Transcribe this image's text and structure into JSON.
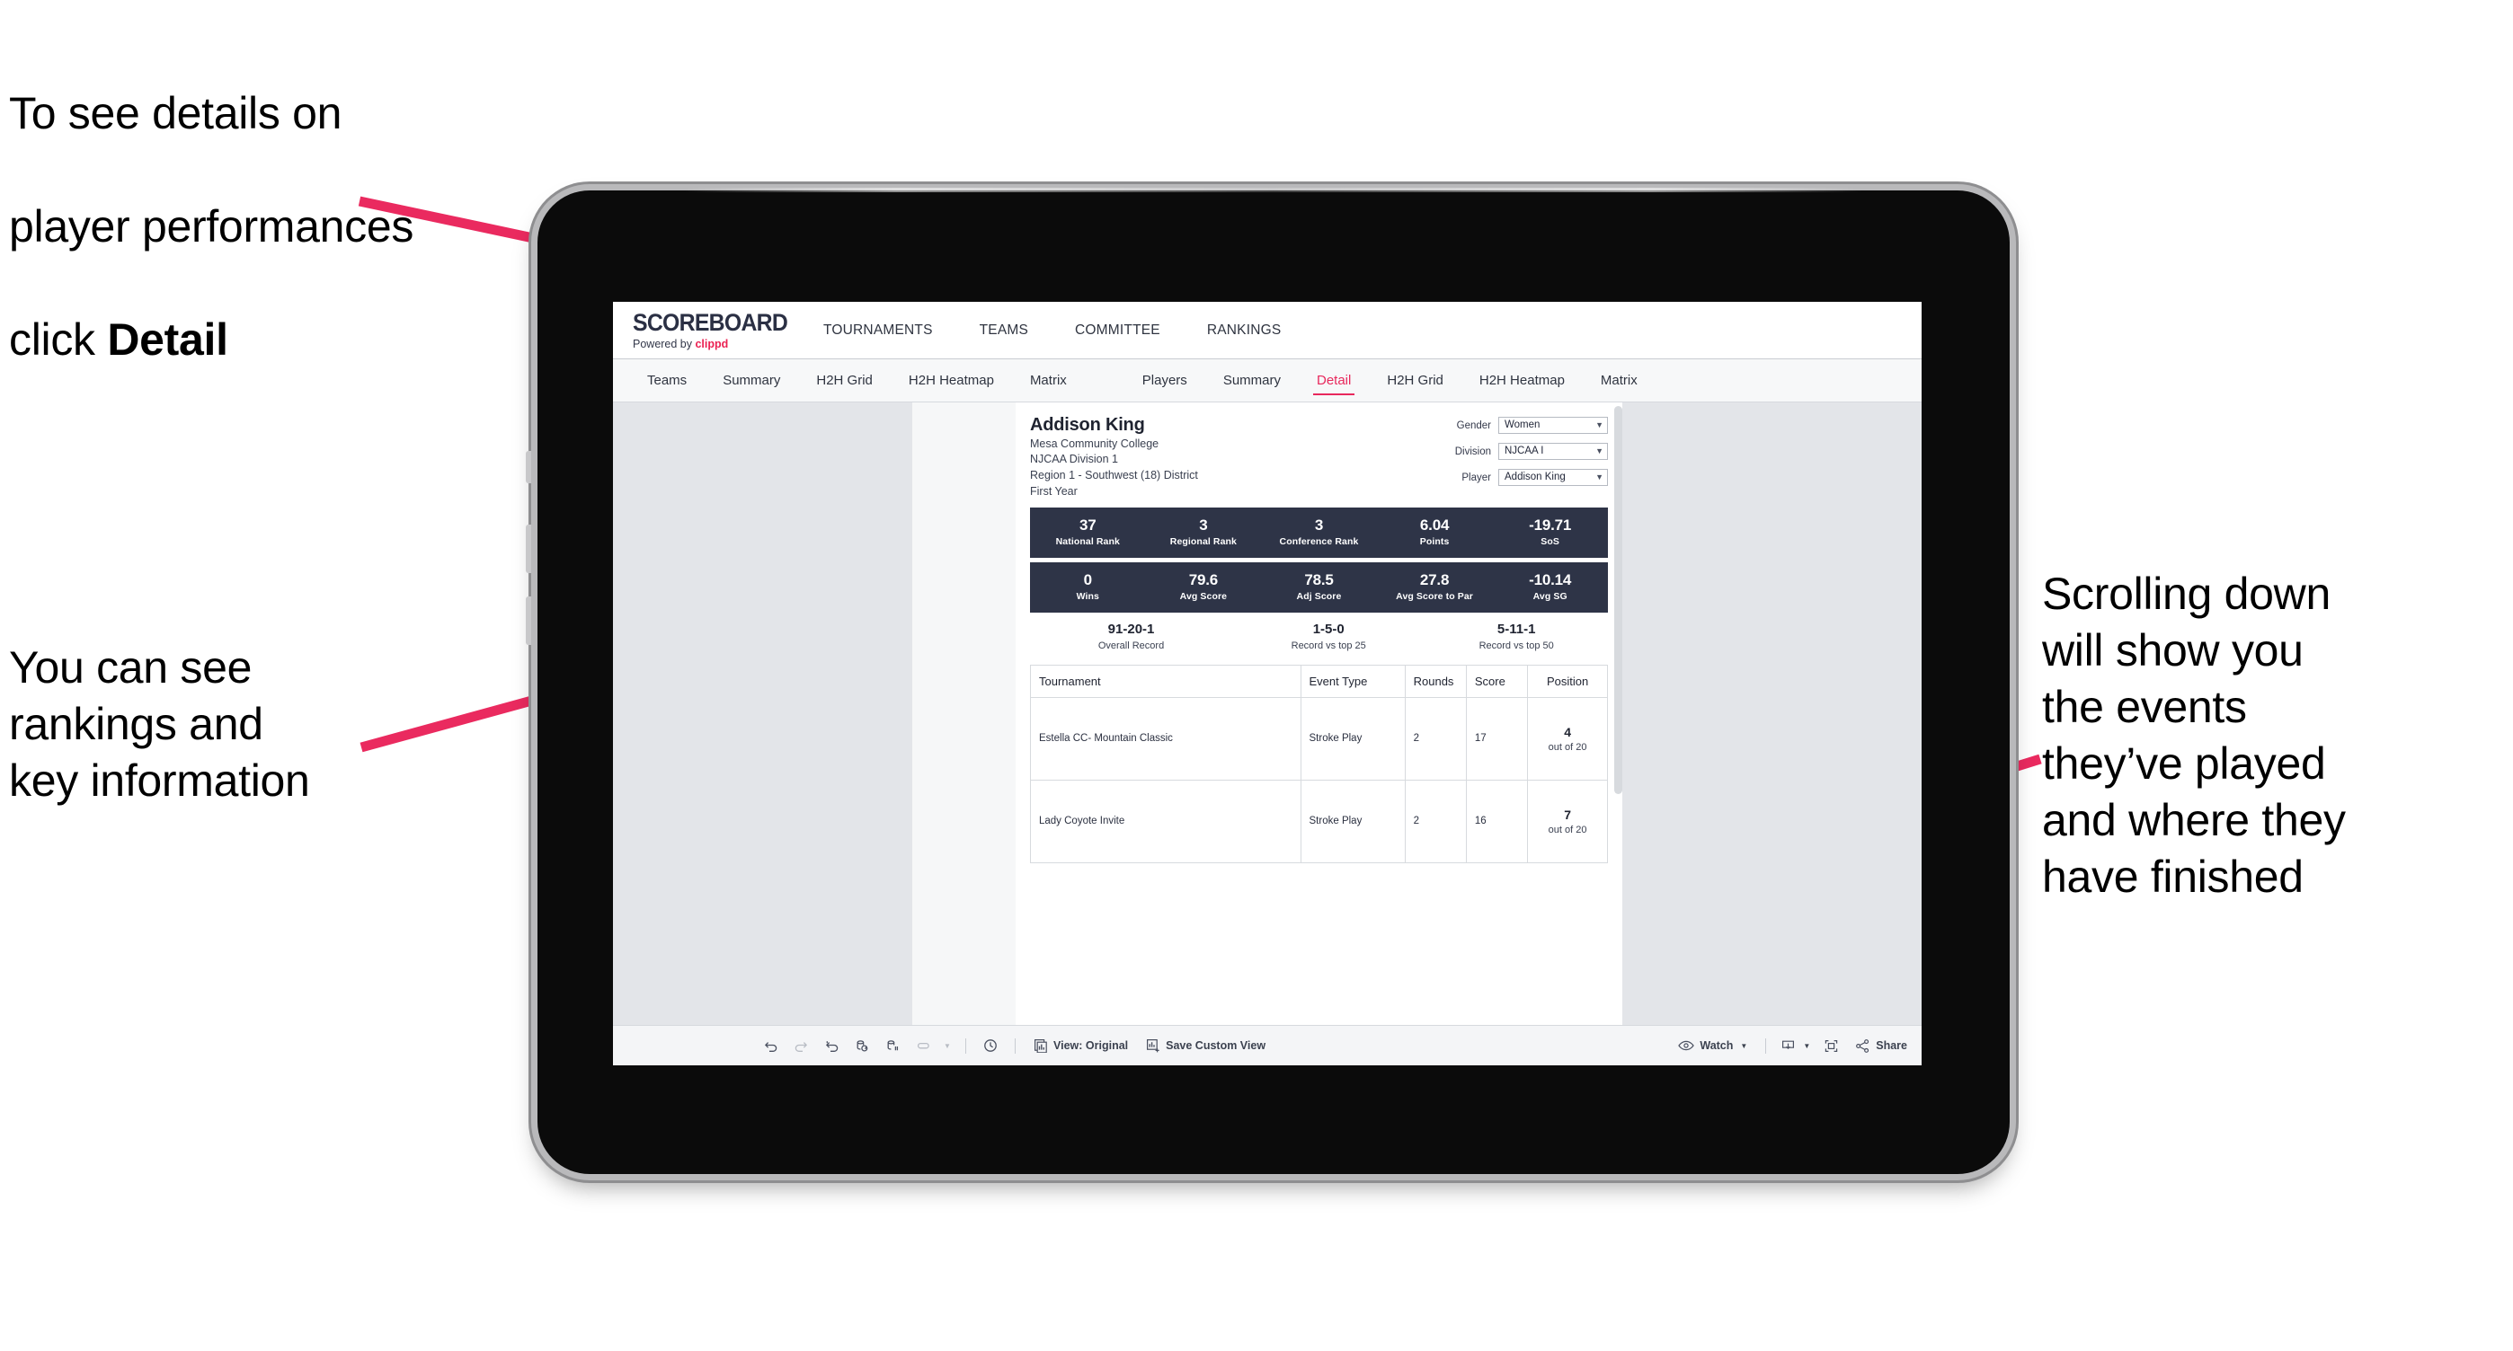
{
  "annotations": {
    "detail_note_line1": "To see details on",
    "detail_note_line2": "player performances",
    "detail_note_line3_prefix": "click ",
    "detail_note_line3_bold": "Detail",
    "rankings_note": "You can see\nrankings and\nkey information",
    "scroll_note": "Scrolling down\nwill show you\nthe events\nthey’ve played\nand where they\nhave finished",
    "arrow_color": "#ea2a5f"
  },
  "brand": {
    "logo_word": "SCOREBOARD",
    "logo_sub_prefix": "Powered by ",
    "logo_sub_brand": "clippd",
    "nav": [
      {
        "label": "TOURNAMENTS"
      },
      {
        "label": "TEAMS"
      },
      {
        "label": "COMMITTEE"
      },
      {
        "label": "RANKINGS"
      }
    ]
  },
  "tabstrip": {
    "team_tabs": [
      {
        "label": "Teams",
        "active": false
      },
      {
        "label": "Summary",
        "active": false
      },
      {
        "label": "H2H Grid",
        "active": false
      },
      {
        "label": "H2H Heatmap",
        "active": false
      },
      {
        "label": "Matrix",
        "active": false
      }
    ],
    "player_tabs": [
      {
        "label": "Players",
        "active": false
      },
      {
        "label": "Summary",
        "active": false
      },
      {
        "label": "Detail",
        "active": true
      },
      {
        "label": "H2H Grid",
        "active": false
      },
      {
        "label": "H2H Heatmap",
        "active": false
      },
      {
        "label": "Matrix",
        "active": false
      }
    ],
    "active_color": "#e8285c"
  },
  "player": {
    "name": "Addison King",
    "school": "Mesa Community College",
    "division": "NJCAA Division 1",
    "region": "Region 1 - Southwest (18) District",
    "class_year": "First Year"
  },
  "filters": [
    {
      "label": "Gender",
      "value": "Women"
    },
    {
      "label": "Division",
      "value": "NJCAA I"
    },
    {
      "label": "Player",
      "value": "Addison King"
    }
  ],
  "kpi_band_1": [
    {
      "value": "37",
      "label": "National Rank"
    },
    {
      "value": "3",
      "label": "Regional Rank"
    },
    {
      "value": "3",
      "label": "Conference Rank"
    },
    {
      "value": "6.04",
      "label": "Points"
    },
    {
      "value": "-19.71",
      "label": "SoS"
    }
  ],
  "kpi_band_2": [
    {
      "value": "0",
      "label": "Wins"
    },
    {
      "value": "79.6",
      "label": "Avg Score"
    },
    {
      "value": "78.5",
      "label": "Adj Score"
    },
    {
      "value": "27.8",
      "label": "Avg Score to Par"
    },
    {
      "value": "-10.14",
      "label": "Avg SG"
    }
  ],
  "records": [
    {
      "value": "91-20-1",
      "label": "Overall Record"
    },
    {
      "value": "1-5-0",
      "label": "Record vs top 25"
    },
    {
      "value": "5-11-1",
      "label": "Record vs top 50"
    }
  ],
  "events_table": {
    "headers": [
      "Tournament",
      "Event Type",
      "Rounds",
      "Score",
      "Position"
    ],
    "rows": [
      {
        "tournament": "Estella CC- Mountain Classic",
        "event_type": "Stroke Play",
        "rounds": "2",
        "score": "17",
        "position_num": "4",
        "position_out": "out of 20"
      },
      {
        "tournament": "Lady Coyote Invite",
        "event_type": "Stroke Play",
        "rounds": "2",
        "score": "16",
        "position_num": "7",
        "position_out": "out of 20"
      }
    ]
  },
  "bottom_toolbar": {
    "view_label": "View: Original",
    "save_label": "Save Custom View",
    "watch_label": "Watch",
    "share_label": "Share"
  },
  "colors": {
    "kpi_band_bg": "#2e3447",
    "accent_pink": "#e8285c",
    "canvas_bg": "#e3e5e9"
  }
}
